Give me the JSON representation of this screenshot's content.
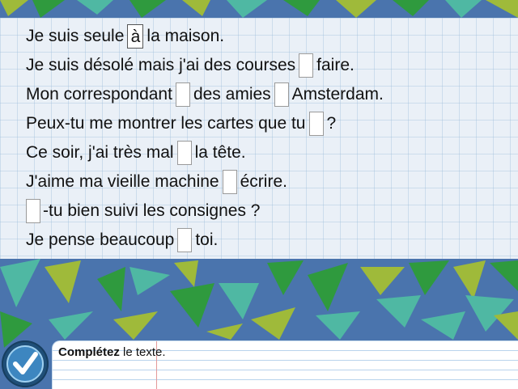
{
  "sentences": [
    {
      "before": "Je suis seule",
      "blank1": "à",
      "middle": "la maison.",
      "blank2": null,
      "after": ""
    },
    {
      "before": "Je suis désolé mais j'ai des courses",
      "blank1": "",
      "middle": "faire.",
      "blank2": null,
      "after": ""
    },
    {
      "before": "Mon correspondant",
      "blank1": "",
      "middle": "des amies",
      "blank2": "",
      "after": "Amsterdam."
    },
    {
      "before": "Peux-tu me montrer les cartes que tu",
      "blank1": "",
      "middle": "?",
      "blank2": null,
      "after": ""
    },
    {
      "before": "Ce soir, j'ai très mal",
      "blank1": "",
      "middle": "la tête.",
      "blank2": null,
      "after": ""
    },
    {
      "before": "J'aime ma vieille machine",
      "blank1": "",
      "middle": "écrire.",
      "blank2": null,
      "after": ""
    },
    {
      "before": "",
      "blank1": "",
      "middle": "-tu bien suivi les consignes ?",
      "blank2": null,
      "after": ""
    },
    {
      "before": "Je pense beaucoup",
      "blank1": "",
      "middle": "toi.",
      "blank2": null,
      "after": ""
    }
  ],
  "instruction": {
    "bold": "Complétez",
    "rest": " le texte."
  },
  "check_button": {
    "icon": "checkmark-icon"
  },
  "colors": {
    "background": "#4a74ad",
    "triangle_green": "#2f9a3e",
    "triangle_teal": "#4fb8a3",
    "triangle_olive": "#9fba3a",
    "check_button": "#3d86c0"
  }
}
